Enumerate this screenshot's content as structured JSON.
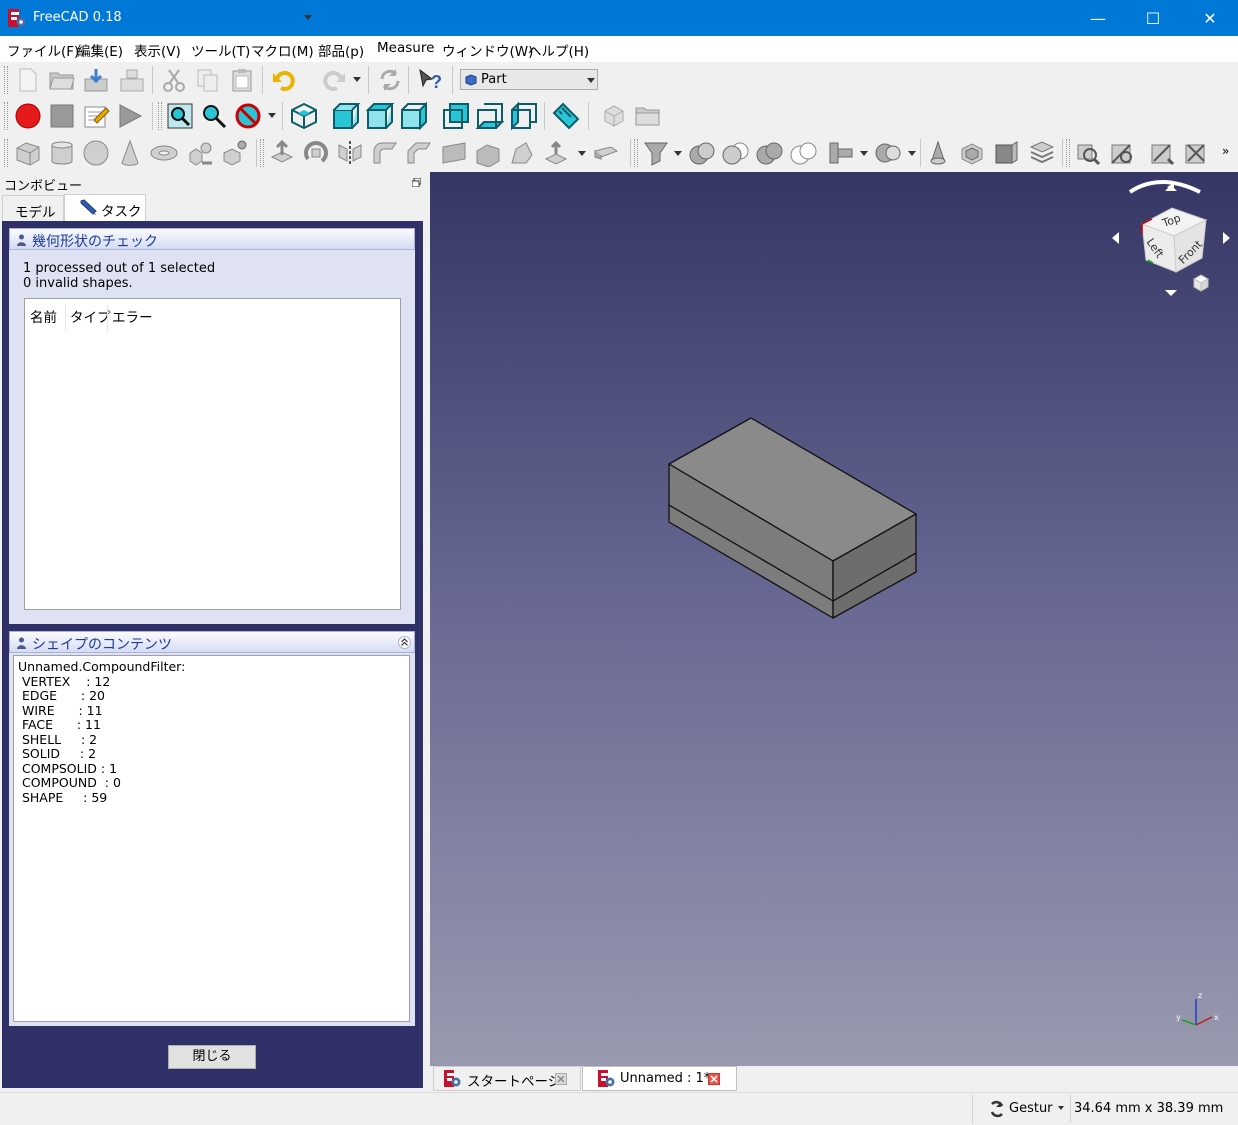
{
  "window": {
    "title": "FreeCAD 0.18",
    "minimize": "—",
    "maximize": "☐",
    "close": "✕"
  },
  "menu": [
    "ファイル(F)",
    "編集(E)",
    "表示(V)",
    "ツール(T)",
    "マクロ(M)",
    "部品(p)",
    "Measure",
    "ウィンドウ(W)",
    "ヘルプ(H)"
  ],
  "workbench": {
    "selected": "Part"
  },
  "combo_view": {
    "title": "コンボビュー",
    "tabs": [
      "モデル",
      "タスク"
    ]
  },
  "geometry_check": {
    "title": "幾何形状のチェック",
    "summary_line1": "1 processed out of 1 selected",
    "summary_line2": "0 invalid shapes.",
    "columns": [
      "名前",
      "タイプ",
      "エラー"
    ]
  },
  "shape_content": {
    "title": "シェイプのコンテンツ",
    "lines": [
      "Unnamed.CompoundFilter:",
      " VERTEX    : 12",
      " EDGE      : 20",
      " WIRE      : 11",
      " FACE      : 11",
      " SHELL     : 2",
      " SOLID     : 2",
      " COMPSOLID : 1",
      " COMPOUND  : 0",
      " SHAPE     : 59"
    ]
  },
  "close_button": "閉じる",
  "navcube": {
    "top": "Top",
    "front": "Front",
    "left": "Left"
  },
  "axis": {
    "x": "x",
    "y": "y",
    "z": "z"
  },
  "doc_tabs": [
    "スタートページ",
    "Unnamed : 1*"
  ],
  "status": {
    "nav_style": "Gestur",
    "dimensions": "34.64 mm x 38.39 mm"
  },
  "colors": {
    "titlebar": "#0078d7",
    "viewport_top": "#363666",
    "viewport_bottom": "#9999af",
    "panel_bg": "#303068",
    "toolbar_cyan": "#29c5d6",
    "record_red": "#e51b1b"
  }
}
